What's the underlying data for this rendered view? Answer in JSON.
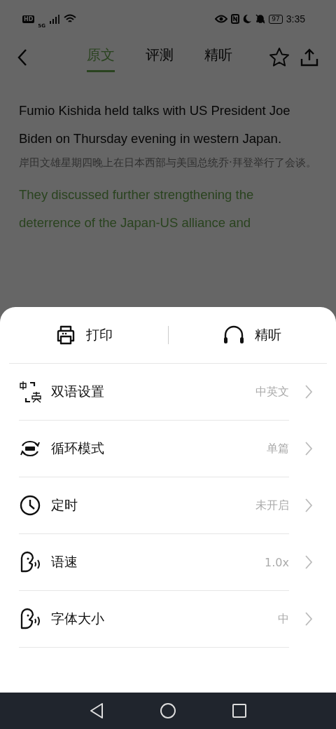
{
  "status_bar": {
    "hd": "HD",
    "network": "5G",
    "battery": "97",
    "time": "3:35"
  },
  "tabs": [
    {
      "label": "原文",
      "selected": true
    },
    {
      "label": "评测",
      "selected": false
    },
    {
      "label": "精听",
      "selected": false
    }
  ],
  "article": [
    {
      "kind": "english",
      "text": "Fumio Kishida held talks with US President Joe Biden on Thursday evening in western Japan.",
      "highlighted": false
    },
    {
      "kind": "chinese",
      "text": "岸田文雄星期四晚上在日本西部与美国总统乔·拜登举行了会谈。"
    },
    {
      "kind": "english",
      "text": "They discussed further strengthening the deterrence of the Japan-US alliance and",
      "highlighted": true
    }
  ],
  "sheet": {
    "actions": [
      {
        "label": "打印"
      },
      {
        "label": "精听"
      }
    ],
    "items": [
      {
        "label": "双语设置",
        "value": "中英文"
      },
      {
        "label": "循环模式",
        "value": "单篇"
      },
      {
        "label": "定时",
        "value": "未开启"
      },
      {
        "label": "语速",
        "value": "1.0x"
      },
      {
        "label": "字体大小",
        "value": "中"
      }
    ]
  }
}
